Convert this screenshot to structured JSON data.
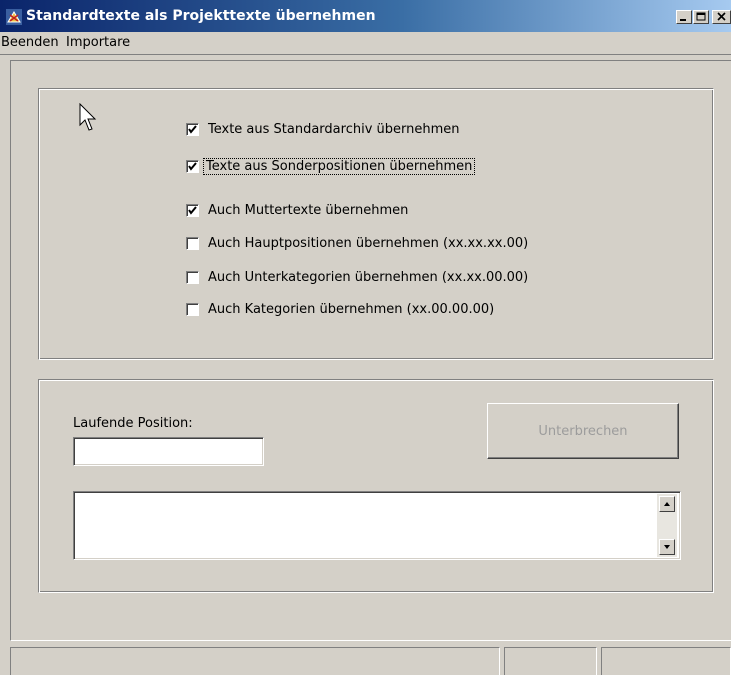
{
  "window": {
    "title": "Standardtexte als Projekttexte übernehmen",
    "controls": [
      "minimize",
      "maximize",
      "close"
    ]
  },
  "menu": {
    "items": [
      "Beenden",
      "Importare"
    ]
  },
  "options": [
    {
      "label": "Texte aus Standardarchiv übernehmen",
      "checked": true
    },
    {
      "label": "Texte aus Sonderpositionen übernehmen",
      "checked": true,
      "focused": true
    },
    {
      "label": "Auch Muttertexte übernehmen",
      "checked": true
    },
    {
      "label": "Auch Hauptpositionen übernehmen (xx.xx.xx.00)",
      "checked": false
    },
    {
      "label": "Auch Unterkategorien übernehmen (xx.xx.00.00)",
      "checked": false
    },
    {
      "label": "Auch Kategorien übernehmen (xx.00.00.00)",
      "checked": false
    }
  ],
  "progress": {
    "position_label": "Laufende Position:",
    "position_value": "",
    "cancel_label": "Unterbrechen",
    "cancel_enabled": false,
    "log_text": ""
  },
  "icons": {
    "app": "app-icon",
    "cursor": "mouse-pointer-icon"
  }
}
